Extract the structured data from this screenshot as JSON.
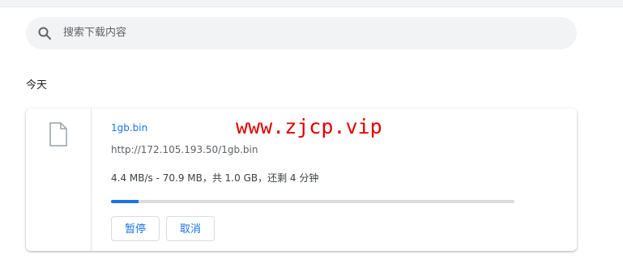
{
  "search": {
    "placeholder": "搜索下载内容",
    "icon": "search-icon"
  },
  "section": {
    "title": "今天"
  },
  "download": {
    "file_name": "1gb.bin",
    "url": "http://172.105.193.50/1gb.bin",
    "status": "4.4 MB/s - 70.9 MB，共 1.0 GB，还剩 4 分钟",
    "progress_fraction": 0.0692,
    "file_icon": "file-icon",
    "pause_label": "暂停",
    "cancel_label": "取消"
  },
  "watermark": {
    "text": "www.zjcp.vip"
  },
  "colors": {
    "accent": "#1a73e8",
    "watermark": "#e00000"
  }
}
